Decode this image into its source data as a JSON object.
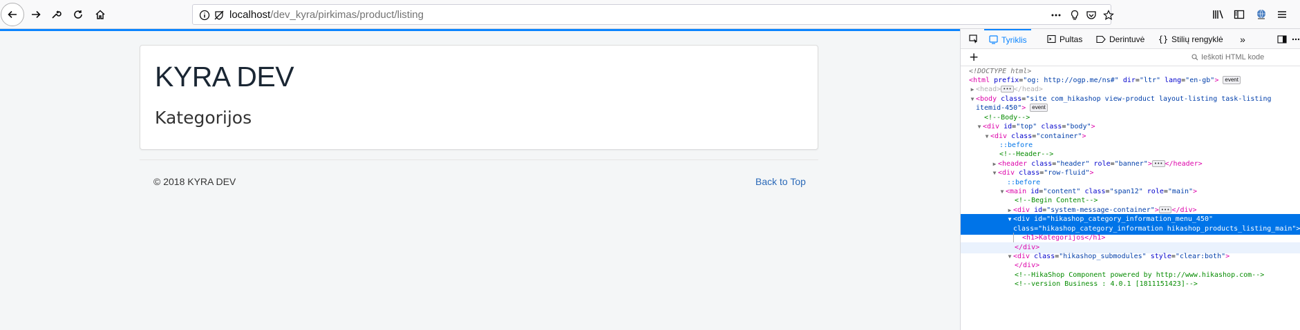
{
  "browser": {
    "url_host": "localhost",
    "url_path": "/dev_kyra/pirkimas/product/listing"
  },
  "page": {
    "site_title": "KYRA DEV",
    "category_heading": "Kategorijos",
    "copyright": "© 2018 KYRA DEV",
    "back_to_top": "Back to Top"
  },
  "devtools": {
    "tabs": [
      {
        "label": "Tyriklis",
        "icon": "inspector-icon",
        "active": true
      },
      {
        "label": "Pultas",
        "icon": "console-icon",
        "active": false
      },
      {
        "label": "Derintuvė",
        "icon": "debugger-icon",
        "active": false
      },
      {
        "label": "Stilių rengyklė",
        "icon": "braces-icon",
        "active": false
      }
    ],
    "search_placeholder": "Ieškoti HTML kode",
    "event_badge": "event",
    "dom": {
      "doctype": "<!DOCTYPE html>",
      "html_tag": "<html",
      "html_attrs": [
        {
          "name": "prefix",
          "value": "\"og: http://ogp.me/ns#\""
        },
        {
          "name": "dir",
          "value": "\"ltr\""
        },
        {
          "name": "lang",
          "value": "\"en-gb\""
        }
      ],
      "head_open": "<head>",
      "head_close": "</head>",
      "body_tag": "<body",
      "body_class_name": "class",
      "body_class_value_1": "\"site com_hikashop view-product layout-listing task-listing",
      "body_class_value_2": "itemid-450\"",
      "comment_body": "<!--Body-->",
      "div_top_tag": "<div",
      "div_top_id_name": "id",
      "div_top_id_value": "\"top\"",
      "div_top_class_name": "class",
      "div_top_class_value": "\"body\"",
      "div_container_tag": "<div",
      "div_container_class_name": "class",
      "div_container_class_value": "\"container\"",
      "before_1": "::before",
      "comment_header": "<!--Header-->",
      "header_tag": "<header",
      "header_class_name": "class",
      "header_class_value": "\"header\"",
      "header_role_name": "role",
      "header_role_value": "\"banner\"",
      "header_close": "</header>",
      "div_row_tag": "<div",
      "div_row_class_name": "class",
      "div_row_class_value": "\"row-fluid\"",
      "before_2": "::before",
      "main_tag": "<main",
      "main_id_name": "id",
      "main_id_value": "\"content\"",
      "main_class_name": "class",
      "main_class_value": "\"span12\"",
      "main_role_name": "role",
      "main_role_value": "\"main\"",
      "comment_begin": "<!--Begin Content-->",
      "div_sys_tag": "<div",
      "div_sys_id_name": "id",
      "div_sys_id_value": "\"system-message-container\"",
      "div_close": "</div>",
      "sel_line_1": "<div id=\"hikashop_category_information_menu_450\"",
      "sel_line_2": "class=\"hikashop_category_information hikashop_products_listing_main\">",
      "h1_line": "<h1>Kategorijos</h1>",
      "div_close_2": "</div>",
      "div_sub_tag": "<div",
      "div_sub_class_name": "class",
      "div_sub_class_value": "\"hikashop_submodules\"",
      "div_sub_style_name": "style",
      "div_sub_style_value": "\"clear:both\"",
      "div_close_3": "</div>",
      "comment_hika": "<!--HikaShop Component powered by http://www.hikashop.com-->",
      "comment_version": "<!--version Business : 4.0.1 [1811151423]-->"
    }
  },
  "colors": {
    "accent": "#0a84ff",
    "selection": "#0074e8",
    "link": "#2a69b8"
  }
}
